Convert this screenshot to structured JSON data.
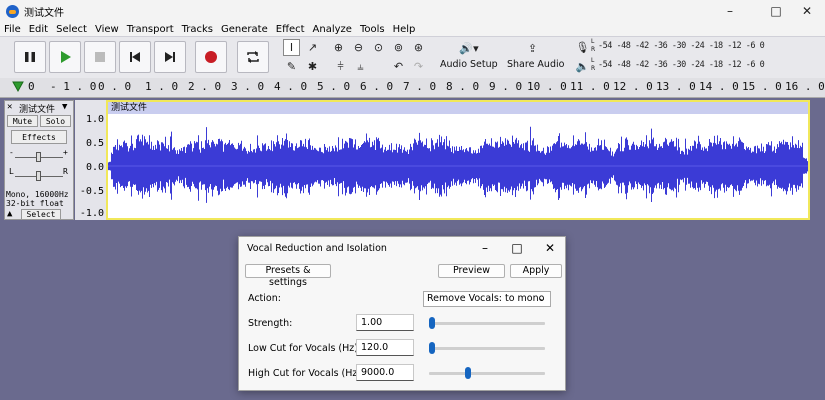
{
  "window": {
    "title": "测试文件",
    "minimize_icon": "minimize-icon",
    "maximize_icon": "maximize-icon",
    "close_icon": "close-icon"
  },
  "menu": [
    "File",
    "Edit",
    "Select",
    "View",
    "Transport",
    "Tracks",
    "Generate",
    "Effect",
    "Analyze",
    "Tools",
    "Help"
  ],
  "toolbar": {
    "audio_setup_label": "Audio Setup",
    "share_audio_label": "Share Audio",
    "record_meter_scale": "-54 -48 -42 -36 -30 -24 -18 -12 -6 0",
    "play_meter_scale": "-54 -48 -42 -36 -30 -24 -18 -12 -6 0",
    "meter_l": "L",
    "meter_r": "R",
    "colors": {
      "play": "#2e9b2e",
      "record": "#c81d25"
    }
  },
  "ruler": {
    "ticks": [
      "0",
      "- 1 . 0",
      "0 . 0",
      "1 . 0",
      "2 . 0",
      "3 . 0",
      "4 . 0",
      "5 . 0",
      "6 . 0",
      "7 . 0",
      "8 . 0",
      "9 . 0",
      "10 . 0",
      "11 . 0",
      "12 . 0",
      "13 . 0",
      "14 . 0",
      "15 . 0",
      "16 . 0"
    ]
  },
  "track": {
    "name": "测试文件",
    "mute_label": "Mute",
    "solo_label": "Solo",
    "effects_label": "Effects",
    "gain_minus": "-",
    "gain_plus": "+",
    "pan_left": "L",
    "pan_right": "R",
    "info_line1": "Mono, 16000Hz",
    "info_line2": "32-bit float",
    "select_label": "Select",
    "clip_name": "测试文件",
    "scale": [
      "1.0",
      "0.5",
      "0.0",
      "-0.5",
      "-1.0"
    ],
    "wave_color": "#3b3bd6"
  },
  "dialog": {
    "title": "Vocal Reduction and Isolation",
    "presets_label": "Presets & settings",
    "preview_label": "Preview",
    "apply_label": "Apply",
    "action_label": "Action:",
    "action_value": "Remove Vocals: to mono",
    "strength_label": "Strength:",
    "strength_value": "1.00",
    "lowcut_label": "Low Cut for Vocals (Hz):",
    "lowcut_value": "120.0",
    "highcut_label": "High Cut for Vocals (Hz):",
    "highcut_value": "9000.0",
    "strength_slider_fraction": 0.0,
    "lowcut_slider_fraction": 0.0,
    "highcut_slider_fraction": 0.33,
    "accent": "#1565c0"
  }
}
